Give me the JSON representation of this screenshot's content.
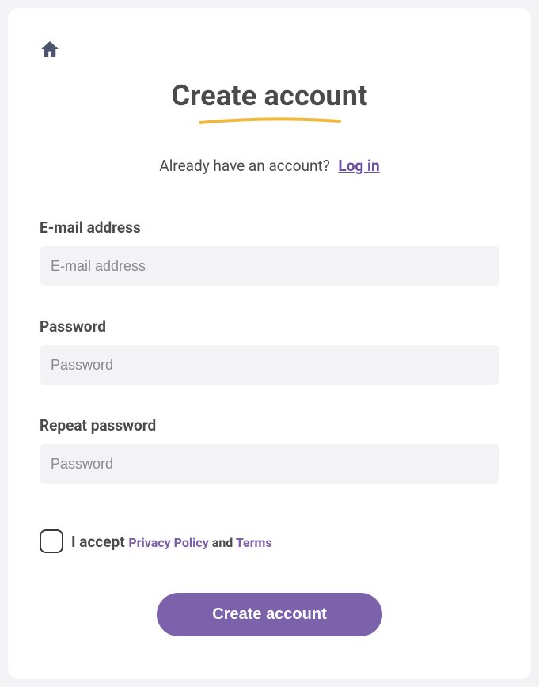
{
  "title": "Create account",
  "login_prompt": {
    "text": "Already have an account?",
    "link": "Log in"
  },
  "fields": {
    "email": {
      "label": "E-mail address",
      "placeholder": "E-mail address",
      "value": ""
    },
    "password": {
      "label": "Password",
      "placeholder": "Password",
      "value": ""
    },
    "repeat_password": {
      "label": "Repeat password",
      "placeholder": "Password",
      "value": ""
    }
  },
  "accept": {
    "checked": false,
    "prefix": "I accept ",
    "privacy": "Privacy Policy",
    "and": " and ",
    "terms": "Terms"
  },
  "submit_label": "Create account",
  "colors": {
    "accent": "#7c62aa",
    "underline": "#f0b83d",
    "text": "#4a4a4a",
    "link": "#6b4fa0",
    "input_bg": "#f3f3f5"
  }
}
